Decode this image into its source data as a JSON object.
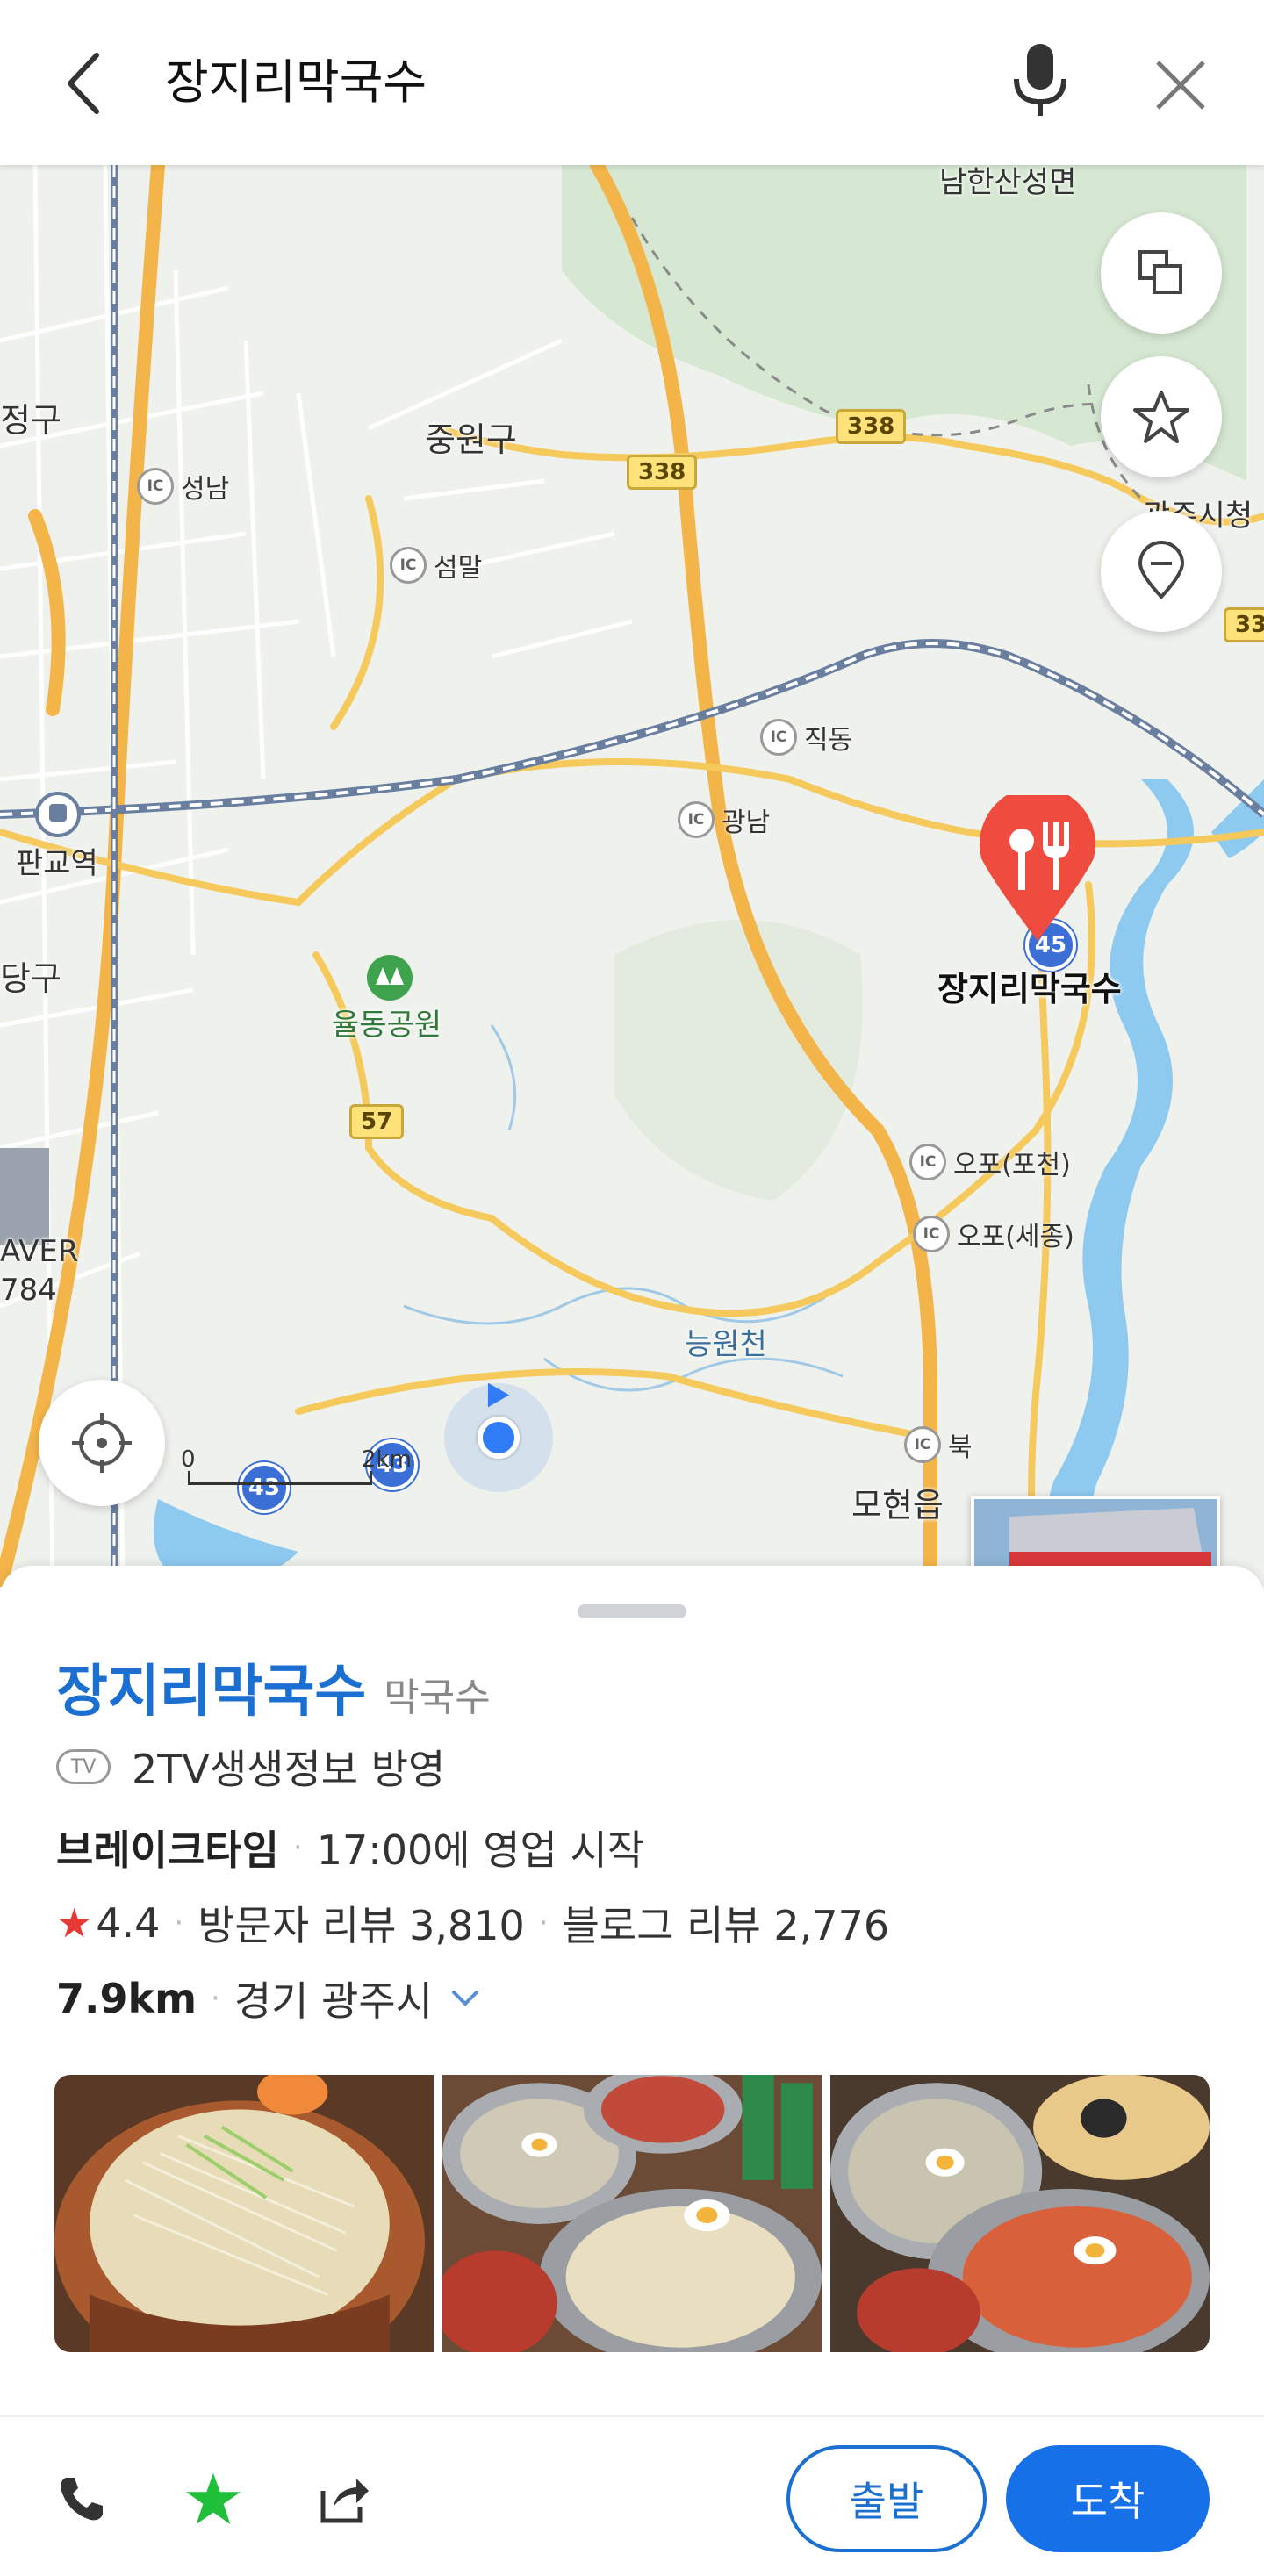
{
  "header": {
    "search_query": "장지리막국수",
    "back_icon": "chevron-left-icon",
    "mic_icon": "microphone-icon",
    "close_icon": "close-icon"
  },
  "map": {
    "area_labels": [
      "남한산성면",
      "중원구",
      "정구",
      "판교역",
      "당구",
      "율동공원",
      "능원천",
      "모현읍",
      "광주시청",
      "AVER",
      "784"
    ],
    "ic_labels": [
      "성남",
      "섬말",
      "직동",
      "광남",
      "오포(포천)",
      "오포(세종)",
      "북"
    ],
    "road_numbers": [
      "338",
      "338",
      "57",
      "33"
    ],
    "highway_numbers": [
      "45",
      "43",
      "43",
      "45"
    ],
    "poi_label": "장지리막국수",
    "scale": {
      "start": "0",
      "end": "2km"
    },
    "colors": {
      "pin": "#ef4b3f",
      "user": "#2f7cf6",
      "water": "#8ec9f0"
    }
  },
  "sheet": {
    "place_name": "장지리막국수",
    "category": "막국수",
    "tv_badge": "TV",
    "tv_text": "2TV생생정보 방영",
    "status_strong": "브레이크타임",
    "status_text": "17:00에 영업 시작",
    "rating": "4.4",
    "visitor_reviews": "방문자 리뷰 3,810",
    "blog_reviews": "블로그 리뷰 2,776",
    "distance": "7.9km",
    "address": "경기 광주시",
    "photos": [
      "photo-1",
      "photo-2",
      "photo-3"
    ]
  },
  "actions": {
    "depart": "출발",
    "arrive": "도착",
    "accent": "#1670e8"
  }
}
